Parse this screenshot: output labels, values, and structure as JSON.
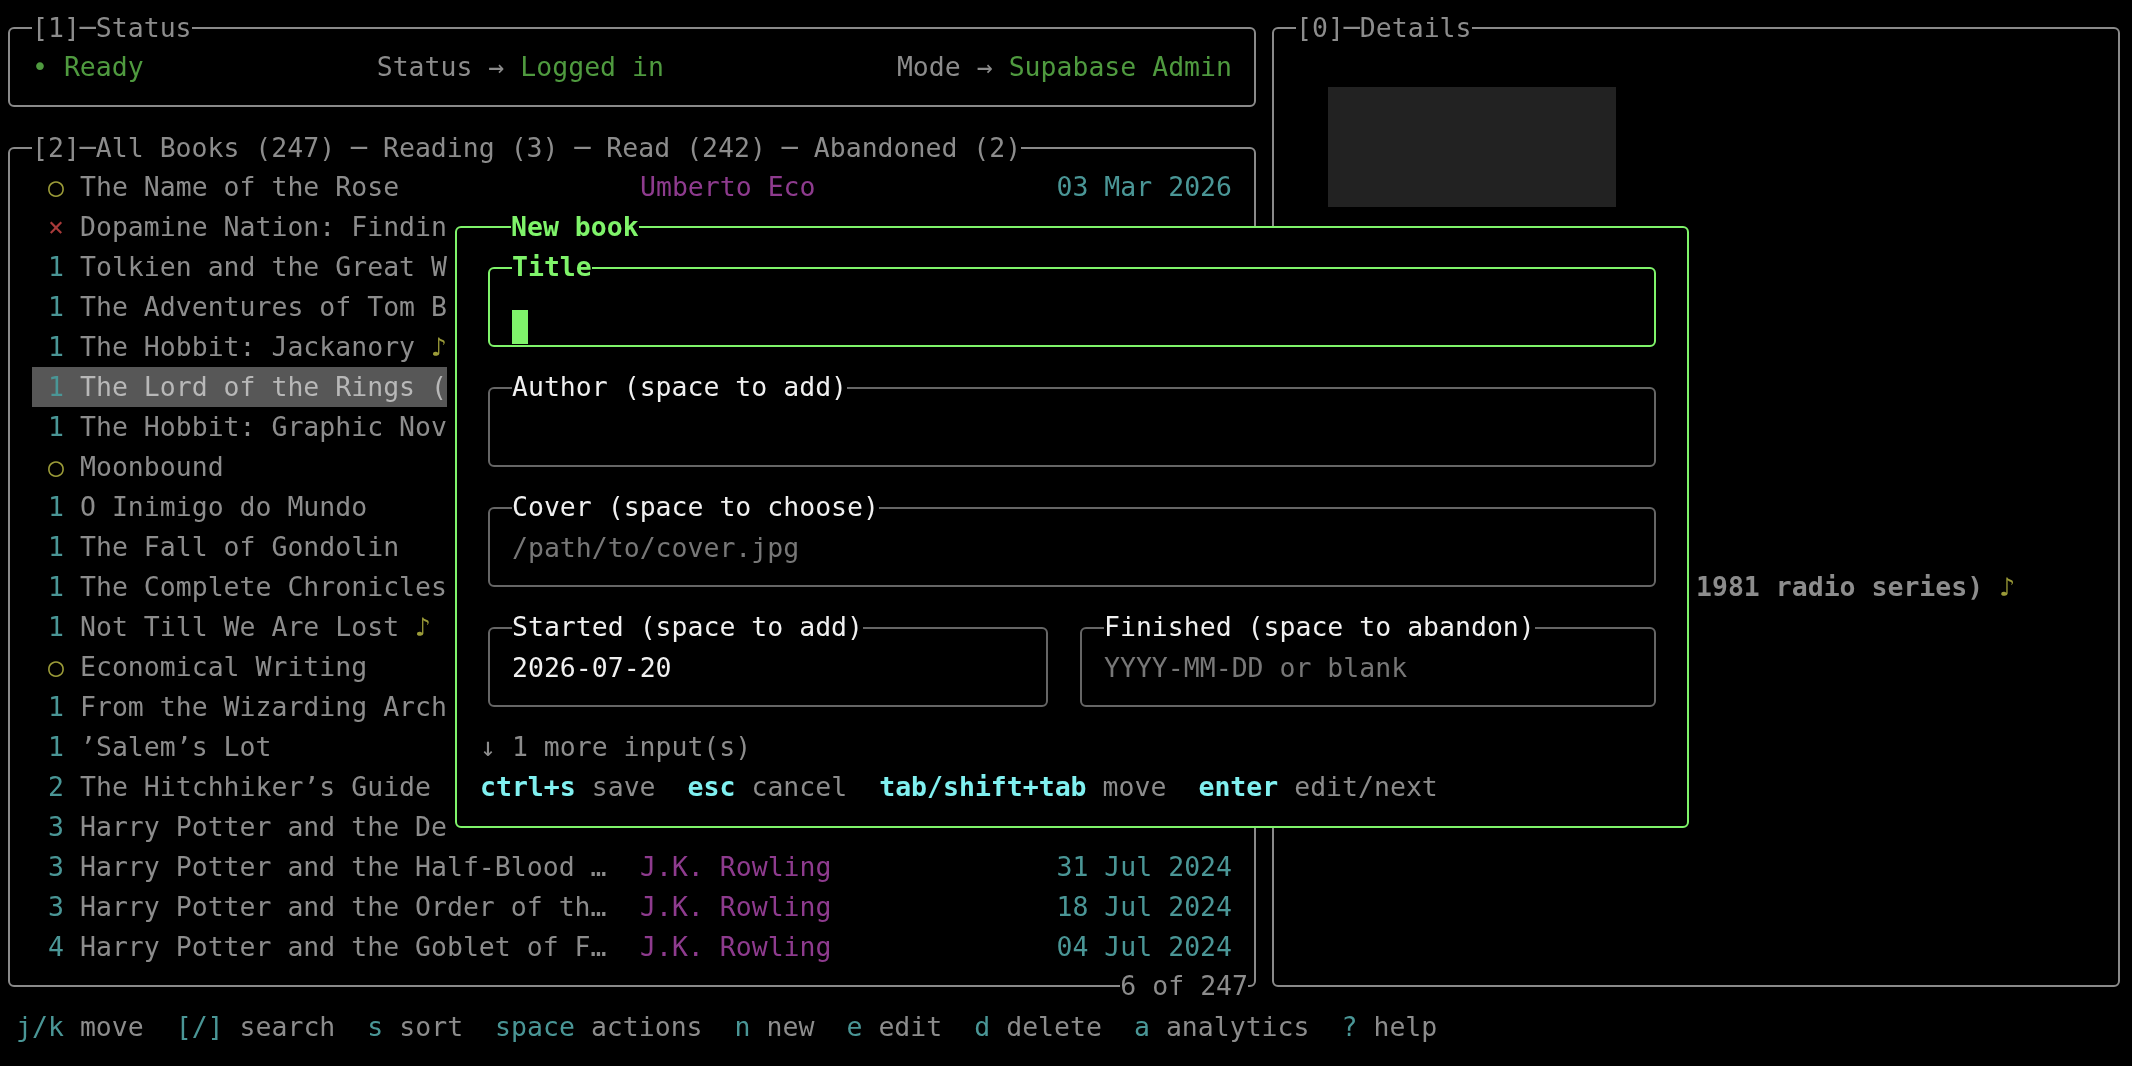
{
  "status": {
    "title": "[1]─Status",
    "indicator": "• Ready",
    "fields": [
      {
        "label": "Status →",
        "value": "Logged in"
      },
      {
        "label": "Mode →",
        "value": "Supabase Admin"
      }
    ]
  },
  "books": {
    "title": "[2]─All Books (247) ─ Reading (3) ─ Read (242) ─ Abandoned (2)",
    "position": "6 of 247",
    "items": [
      {
        "marker": "○",
        "kind": "reading",
        "title": "The Name of the Rose",
        "author": "Umberto Eco",
        "date": "03 Mar 2026",
        "selected": false
      },
      {
        "marker": "×",
        "kind": "abandoned",
        "title": "Dopamine Nation: Findin",
        "selected": false
      },
      {
        "marker": "1",
        "kind": "read",
        "title": "Tolkien and the Great W",
        "selected": false
      },
      {
        "marker": "1",
        "kind": "read",
        "title": "The Adventures of Tom B",
        "selected": false
      },
      {
        "marker": "1",
        "kind": "read",
        "title": "The Hobbit: Jackanory",
        "note": "♪",
        "selected": false
      },
      {
        "marker": "1",
        "kind": "read",
        "title": "The Lord of the Rings (",
        "selected": true
      },
      {
        "marker": "1",
        "kind": "read",
        "title": "The Hobbit: Graphic Nov",
        "selected": false
      },
      {
        "marker": "○",
        "kind": "reading",
        "title": "Moonbound",
        "selected": false
      },
      {
        "marker": "1",
        "kind": "read",
        "title": "O Inimigo do Mundo",
        "selected": false
      },
      {
        "marker": "1",
        "kind": "read",
        "title": "The Fall of Gondolin",
        "selected": false
      },
      {
        "marker": "1",
        "kind": "read",
        "title": "The Complete Chronicles",
        "selected": false
      },
      {
        "marker": "1",
        "kind": "read",
        "title": "Not Till We Are Lost",
        "note": "♪",
        "selected": false
      },
      {
        "marker": "○",
        "kind": "reading",
        "title": "Economical Writing",
        "selected": false
      },
      {
        "marker": "1",
        "kind": "read",
        "title": "From the Wizarding Arch",
        "selected": false
      },
      {
        "marker": "1",
        "kind": "read",
        "title": "’Salem’s Lot",
        "selected": false
      },
      {
        "marker": "2",
        "kind": "read",
        "title": "The Hitchhiker’s Guide",
        "selected": false
      },
      {
        "marker": "3",
        "kind": "read",
        "title": "Harry Potter and the De",
        "selected": false
      },
      {
        "marker": "3",
        "kind": "read",
        "title": "Harry Potter and the Half-Blood …",
        "author": "J.K. Rowling",
        "date": "31 Jul 2024",
        "selected": false
      },
      {
        "marker": "3",
        "kind": "read",
        "title": "Harry Potter and the Order of th…",
        "author": "J.K. Rowling",
        "date": "18 Jul 2024",
        "selected": false
      },
      {
        "marker": "4",
        "kind": "read",
        "title": "Harry Potter and the Goblet of F…",
        "author": "J.K. Rowling",
        "date": "04 Jul 2024",
        "selected": false
      }
    ]
  },
  "details": {
    "title": "[0]─Details",
    "cover": {
      "kind": "placeholder"
    },
    "heading": "1981 radio series)",
    "heading_note": "♪"
  },
  "dialog": {
    "title": "New book",
    "fields": [
      {
        "label": "Title",
        "focused": true
      },
      {
        "label": "Author (space to add)",
        "focused": false
      },
      {
        "label": "Cover (space to choose)",
        "placeholder": "/path/to/cover.jpg",
        "focused": false
      },
      {
        "label": "Started (space to add)",
        "value": "2026-07-20",
        "focused": false
      },
      {
        "label": "Finished (space to abandon)",
        "placeholder": "YYYY-MM-DD or blank",
        "focused": false
      }
    ],
    "more": "↓ 1 more input(s)",
    "hints": [
      {
        "key": "ctrl+s",
        "action": "save"
      },
      {
        "key": "esc",
        "action": "cancel"
      },
      {
        "key": "tab/shift+tab",
        "action": "move"
      },
      {
        "key": "enter",
        "action": "edit/next"
      }
    ]
  },
  "footer": [
    {
      "key": "j/k",
      "action": "move"
    },
    {
      "key": "[/]",
      "action": "search"
    },
    {
      "key": "s",
      "action": "sort"
    },
    {
      "key": "space",
      "action": "actions"
    },
    {
      "key": "n",
      "action": "new"
    },
    {
      "key": "e",
      "action": "edit"
    },
    {
      "key": "d",
      "action": "delete"
    },
    {
      "key": "a",
      "action": "analytics"
    },
    {
      "key": "?",
      "action": "help"
    }
  ]
}
